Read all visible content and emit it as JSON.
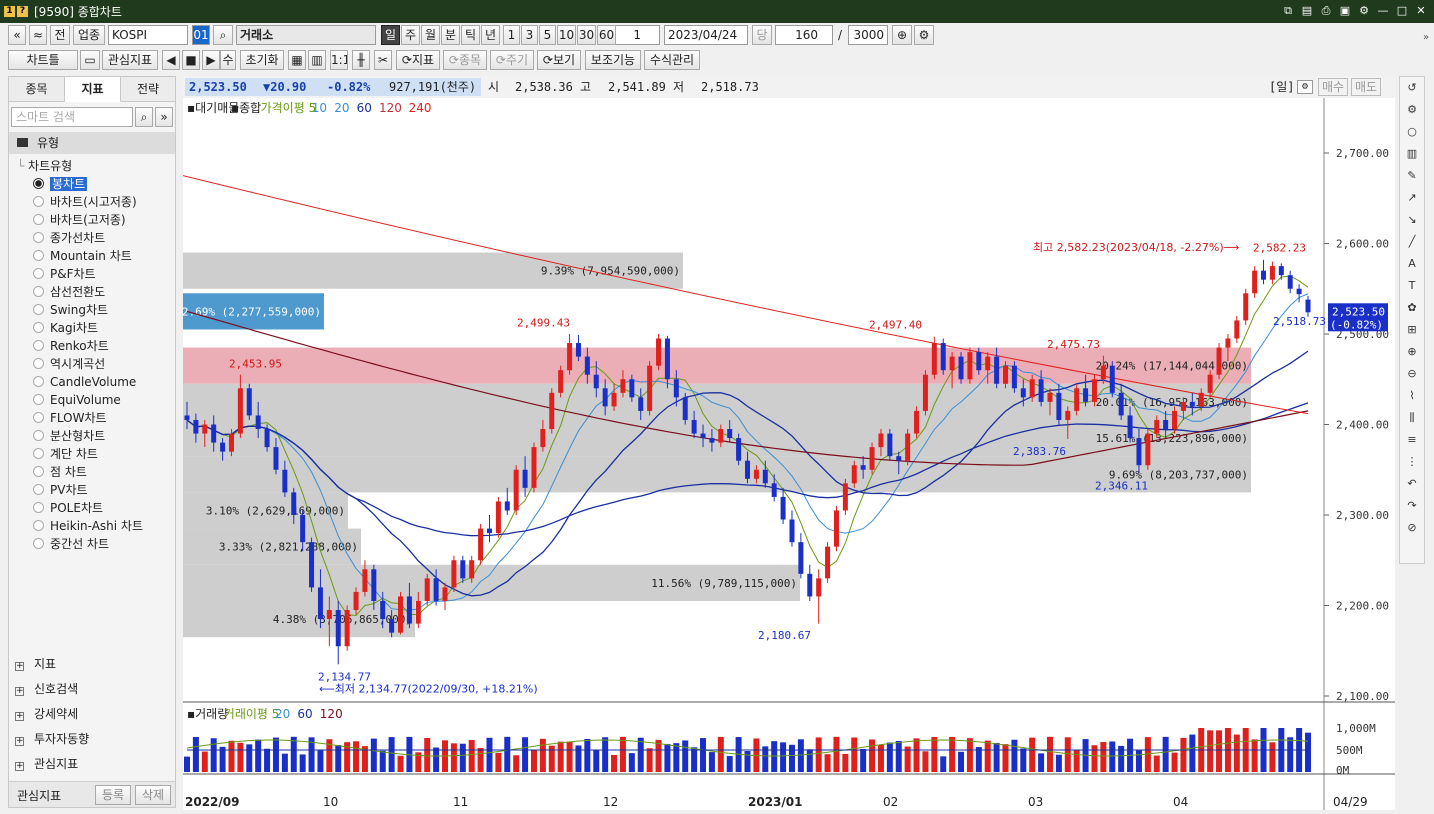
{
  "window": {
    "badge1": "1",
    "badge2": "?",
    "title": "[9590] 종합차트"
  },
  "toolbar1": {
    "nav_first": "«",
    "nav_up": "≈",
    "btn_jeon": "전",
    "market_type": "업종",
    "index_name": "KOSPI",
    "code_box": "01",
    "search_icon": "search-icon",
    "index_label": "거래소",
    "periods": [
      "일",
      "주",
      "월",
      "분",
      "틱",
      "년"
    ],
    "minutes": [
      "1",
      "3",
      "5",
      "10",
      "30",
      "60"
    ],
    "interval_value": "1",
    "date": "2023/04/24",
    "dang_label": "당",
    "count": "160",
    "slash": "/",
    "total": "3000"
  },
  "toolbar2": {
    "chart_tab": "차트틀",
    "watch_indicator": "관심지표",
    "su": "수",
    "reset": "초기화",
    "indicator": "지표",
    "stock": "종목",
    "cycle": "주기",
    "view": "보기",
    "aux": "보조기능",
    "formula": "수식관리"
  },
  "left_panel": {
    "tabs": [
      "종목",
      "지표",
      "전략"
    ],
    "search_placeholder": "스마트 검색",
    "category": "유형",
    "tree_root": "차트유형",
    "chart_types": [
      "봉차트",
      "바차트(시고저종)",
      "바차트(고저종)",
      "종가선차트",
      "Mountain 차트",
      "P&F차트",
      "삼선전환도",
      "Swing차트",
      "Kagi차트",
      "Renko차트",
      "역시계곡선",
      "CandleVolume",
      "EquiVolume",
      "FLOW차트",
      "분산형차트",
      "계단 차트",
      "점 차트",
      "PV차트",
      "POLE차트",
      "Heikin-Ashi 차트",
      "중간선 차트"
    ],
    "selected": 0,
    "sections": [
      "지표",
      "신호검색",
      "강세약세",
      "투자자동향",
      "관심지표"
    ],
    "bottom_label": "관심지표",
    "register": "등록",
    "delete": "삭제"
  },
  "info": {
    "price": "2,523.50",
    "change": "▼20.90",
    "pct": "-0.82%",
    "volume": "927,191(천주)",
    "open_label": "시",
    "open": "2,538.36",
    "high_label": "고",
    "high": "2,541.89",
    "low_label": "저",
    "low": "2,518.73",
    "period": "[일]",
    "buy": "매수",
    "sell": "매도"
  },
  "legend": {
    "vol_profile": "대기매물",
    "combo": "종합",
    "ma_label": "가격이평",
    "ma_periods": [
      "5",
      "10",
      "20",
      "60",
      "120",
      "240"
    ],
    "colors": {
      "ma5": "#6b9a12",
      "ma10": "#3a8fd6",
      "ma20": "#1a2fa0",
      "ma60": "#1a2fa0",
      "ma120": "#7a0f1c",
      "ma240": "#e0201c"
    }
  },
  "volume_legend": {
    "title": "거래량",
    "ma_label": "거래이평",
    "periods": [
      "5",
      "20",
      "60",
      "120"
    ],
    "y_ticks": [
      "1,000M",
      "500M",
      "0M"
    ]
  },
  "chart_data": {
    "type": "candlestick",
    "y_axis": {
      "min": 2100,
      "max": 2700,
      "ticks": [
        "2,700.00",
        "2,600.00",
        "2,500.00",
        "2,400.00",
        "2,300.00",
        "2,200.00",
        "2,100.00"
      ]
    },
    "x_labels": [
      "2022/09",
      "10",
      "11",
      "12",
      "2023/01",
      "02",
      "03",
      "04",
      "04/29"
    ],
    "annotations": {
      "max": "최고 2,582.23(2023/04/18, -2.27%)⟶",
      "min": "⟵최저 2,134.77(2022/09/30, +18.21%)",
      "peaks": [
        "2,453.95",
        "2,499.43",
        "2,497.40",
        "2,475.73",
        "2,582.23"
      ],
      "troughs": [
        "2,134.77",
        "2,180.67",
        "2,383.76",
        "2,346.11"
      ],
      "last_low": "2,518.73"
    },
    "volume_profile": [
      {
        "label": "9.39% (7,954,590,000)",
        "lo": 2550,
        "hi": 2590
      },
      {
        "label": "2.69% (2,277,559,000)",
        "lo": 2505,
        "hi": 2545
      },
      {
        "label": "20.24% (17,144,044,000)",
        "lo": 2445,
        "hi": 2485
      },
      {
        "label": "20.01% (16,952,163,000)",
        "lo": 2405,
        "hi": 2445
      },
      {
        "label": "15.61% (13,223,896,000)",
        "lo": 2365,
        "hi": 2405
      },
      {
        "label": "9.69% (8,203,737,000)",
        "lo": 2325,
        "hi": 2365
      },
      {
        "label": "3.10% (2,629,169,000)",
        "lo": 2285,
        "hi": 2325
      },
      {
        "label": "3.33% (2,821,288,000)",
        "lo": 2245,
        "hi": 2285
      },
      {
        "label": "11.56% (9,789,115,000)",
        "lo": 2205,
        "hi": 2245
      },
      {
        "label": "4.38% (3,706,865,000)",
        "lo": 2165,
        "hi": 2205
      }
    ],
    "candles": [
      [
        2410,
        2425,
        2395,
        2405
      ],
      [
        2405,
        2412,
        2380,
        2390
      ],
      [
        2390,
        2405,
        2375,
        2400
      ],
      [
        2400,
        2410,
        2370,
        2380
      ],
      [
        2380,
        2385,
        2360,
        2370
      ],
      [
        2370,
        2395,
        2365,
        2390
      ],
      [
        2390,
        2455,
        2385,
        2440
      ],
      [
        2440,
        2445,
        2405,
        2410
      ],
      [
        2410,
        2425,
        2385,
        2395
      ],
      [
        2395,
        2400,
        2370,
        2375
      ],
      [
        2375,
        2385,
        2345,
        2350
      ],
      [
        2350,
        2360,
        2320,
        2325
      ],
      [
        2325,
        2330,
        2290,
        2300
      ],
      [
        2300,
        2305,
        2260,
        2270
      ],
      [
        2270,
        2275,
        2215,
        2220
      ],
      [
        2220,
        2240,
        2175,
        2185
      ],
      [
        2185,
        2210,
        2155,
        2195
      ],
      [
        2195,
        2205,
        2135,
        2155
      ],
      [
        2155,
        2200,
        2150,
        2195
      ],
      [
        2195,
        2220,
        2190,
        2215
      ],
      [
        2215,
        2250,
        2210,
        2240
      ],
      [
        2240,
        2245,
        2195,
        2205
      ],
      [
        2205,
        2215,
        2175,
        2185
      ],
      [
        2185,
        2195,
        2165,
        2170
      ],
      [
        2170,
        2215,
        2168,
        2210
      ],
      [
        2210,
        2225,
        2175,
        2180
      ],
      [
        2180,
        2215,
        2175,
        2205
      ],
      [
        2205,
        2235,
        2200,
        2230
      ],
      [
        2230,
        2240,
        2200,
        2205
      ],
      [
        2205,
        2225,
        2195,
        2220
      ],
      [
        2220,
        2255,
        2215,
        2250
      ],
      [
        2250,
        2255,
        2225,
        2230
      ],
      [
        2230,
        2255,
        2225,
        2250
      ],
      [
        2250,
        2290,
        2245,
        2285
      ],
      [
        2285,
        2300,
        2270,
        2280
      ],
      [
        2280,
        2320,
        2275,
        2315
      ],
      [
        2315,
        2330,
        2300,
        2305
      ],
      [
        2305,
        2355,
        2300,
        2350
      ],
      [
        2350,
        2365,
        2320,
        2330
      ],
      [
        2330,
        2380,
        2325,
        2375
      ],
      [
        2375,
        2405,
        2370,
        2395
      ],
      [
        2395,
        2440,
        2390,
        2435
      ],
      [
        2435,
        2465,
        2430,
        2460
      ],
      [
        2460,
        2500,
        2455,
        2490
      ],
      [
        2490,
        2499,
        2470,
        2475
      ],
      [
        2475,
        2485,
        2445,
        2455
      ],
      [
        2455,
        2470,
        2430,
        2440
      ],
      [
        2440,
        2450,
        2410,
        2420
      ],
      [
        2420,
        2445,
        2415,
        2435
      ],
      [
        2435,
        2460,
        2430,
        2450
      ],
      [
        2450,
        2455,
        2425,
        2430
      ],
      [
        2430,
        2440,
        2405,
        2415
      ],
      [
        2415,
        2470,
        2410,
        2465
      ],
      [
        2465,
        2500,
        2460,
        2495
      ],
      [
        2495,
        2498,
        2440,
        2450
      ],
      [
        2450,
        2460,
        2420,
        2430
      ],
      [
        2430,
        2435,
        2400,
        2405
      ],
      [
        2405,
        2415,
        2385,
        2390
      ],
      [
        2390,
        2400,
        2375,
        2385
      ],
      [
        2385,
        2395,
        2370,
        2380
      ],
      [
        2380,
        2400,
        2375,
        2395
      ],
      [
        2395,
        2405,
        2380,
        2385
      ],
      [
        2385,
        2390,
        2355,
        2360
      ],
      [
        2360,
        2370,
        2335,
        2340
      ],
      [
        2340,
        2355,
        2335,
        2350
      ],
      [
        2350,
        2360,
        2330,
        2335
      ],
      [
        2335,
        2345,
        2315,
        2320
      ],
      [
        2320,
        2330,
        2290,
        2295
      ],
      [
        2295,
        2305,
        2265,
        2270
      ],
      [
        2270,
        2280,
        2230,
        2235
      ],
      [
        2235,
        2245,
        2205,
        2210
      ],
      [
        2210,
        2240,
        2180,
        2230
      ],
      [
        2230,
        2270,
        2225,
        2265
      ],
      [
        2265,
        2310,
        2260,
        2305
      ],
      [
        2305,
        2340,
        2300,
        2335
      ],
      [
        2335,
        2360,
        2330,
        2355
      ],
      [
        2355,
        2365,
        2340,
        2350
      ],
      [
        2350,
        2380,
        2345,
        2375
      ],
      [
        2375,
        2395,
        2365,
        2390
      ],
      [
        2390,
        2395,
        2360,
        2365
      ],
      [
        2365,
        2370,
        2345,
        2360
      ],
      [
        2360,
        2395,
        2355,
        2390
      ],
      [
        2390,
        2420,
        2385,
        2415
      ],
      [
        2415,
        2460,
        2410,
        2455
      ],
      [
        2455,
        2497,
        2450,
        2490
      ],
      [
        2490,
        2495,
        2455,
        2460
      ],
      [
        2460,
        2480,
        2440,
        2475
      ],
      [
        2475,
        2480,
        2445,
        2450
      ],
      [
        2450,
        2485,
        2445,
        2480
      ],
      [
        2480,
        2485,
        2455,
        2460
      ],
      [
        2460,
        2480,
        2445,
        2475
      ],
      [
        2475,
        2485,
        2440,
        2445
      ],
      [
        2445,
        2470,
        2440,
        2465
      ],
      [
        2465,
        2470,
        2435,
        2440
      ],
      [
        2440,
        2450,
        2420,
        2430
      ],
      [
        2430,
        2455,
        2425,
        2450
      ],
      [
        2450,
        2460,
        2420,
        2425
      ],
      [
        2425,
        2440,
        2410,
        2435
      ],
      [
        2435,
        2445,
        2400,
        2405
      ],
      [
        2405,
        2420,
        2384,
        2415
      ],
      [
        2415,
        2445,
        2410,
        2440
      ],
      [
        2440,
        2455,
        2420,
        2425
      ],
      [
        2425,
        2455,
        2420,
        2450
      ],
      [
        2450,
        2476,
        2445,
        2465
      ],
      [
        2465,
        2470,
        2430,
        2435
      ],
      [
        2435,
        2445,
        2405,
        2410
      ],
      [
        2410,
        2420,
        2380,
        2385
      ],
      [
        2385,
        2395,
        2346,
        2355
      ],
      [
        2355,
        2395,
        2350,
        2390
      ],
      [
        2390,
        2410,
        2385,
        2405
      ],
      [
        2405,
        2415,
        2385,
        2395
      ],
      [
        2395,
        2420,
        2390,
        2415
      ],
      [
        2415,
        2430,
        2405,
        2425
      ],
      [
        2425,
        2435,
        2410,
        2420
      ],
      [
        2420,
        2440,
        2415,
        2435
      ],
      [
        2435,
        2460,
        2430,
        2455
      ],
      [
        2455,
        2490,
        2450,
        2485
      ],
      [
        2485,
        2500,
        2470,
        2495
      ],
      [
        2495,
        2520,
        2490,
        2515
      ],
      [
        2515,
        2550,
        2510,
        2545
      ],
      [
        2545,
        2575,
        2540,
        2570
      ],
      [
        2570,
        2582,
        2555,
        2560
      ],
      [
        2560,
        2580,
        2555,
        2575
      ],
      [
        2575,
        2578,
        2560,
        2565
      ],
      [
        2565,
        2570,
        2545,
        2550
      ],
      [
        2550,
        2555,
        2535,
        2544
      ],
      [
        2538,
        2542,
        2519,
        2524
      ]
    ],
    "ma240_from": 2575,
    "ma240_to": 2412
  },
  "right_toolbar": [
    "↺",
    "⚙",
    "○",
    "▥",
    "✎",
    "↗",
    "↘",
    "╱",
    "A",
    "T",
    "✿",
    "⊞",
    "⊕",
    "⊖",
    "⌇",
    "⫼",
    "≡",
    "⋮",
    "↶",
    "↷",
    "⊘"
  ]
}
